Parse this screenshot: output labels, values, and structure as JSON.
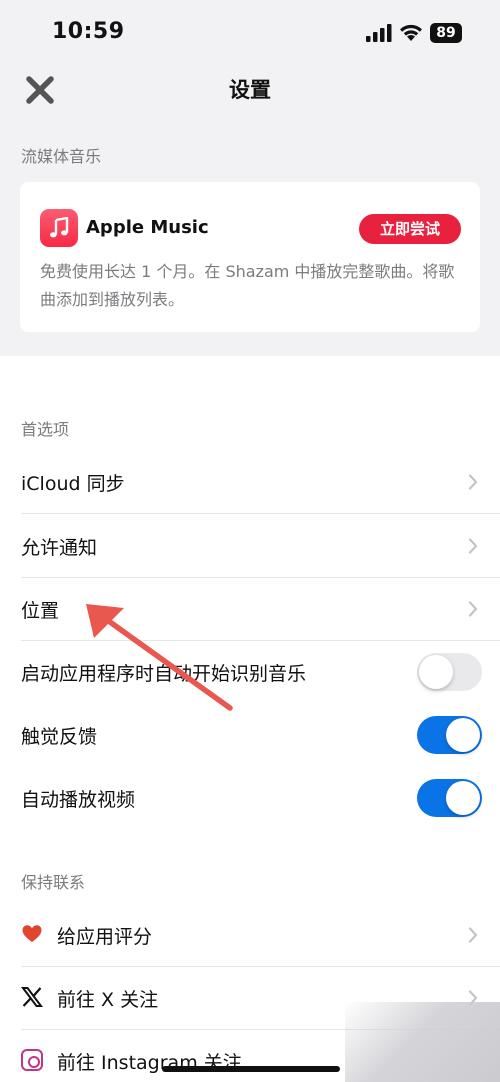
{
  "status_bar": {
    "time": "10:59",
    "battery": "89"
  },
  "nav": {
    "title": "设置"
  },
  "streaming": {
    "section_label": "流媒体音乐",
    "apple_music": {
      "title": "Apple Music",
      "try_button": "立即尝试",
      "description": "免费使用长达 1 个月。在 Shazam 中播放完整歌曲。将歌曲添加到播放列表。"
    }
  },
  "preferences": {
    "section_label": "首选项",
    "items": [
      {
        "label": "iCloud 同步",
        "type": "link"
      },
      {
        "label": "允许通知",
        "type": "link"
      },
      {
        "label": "位置",
        "type": "link"
      },
      {
        "label": "启动应用程序时自动开始识别音乐",
        "type": "toggle",
        "on": false
      },
      {
        "label": "触觉反馈",
        "type": "toggle",
        "on": true
      },
      {
        "label": "自动播放视频",
        "type": "toggle",
        "on": true
      }
    ]
  },
  "contact": {
    "section_label": "保持联系",
    "items": [
      {
        "label": "给应用评分",
        "icon": "heart-icon"
      },
      {
        "label": "前往 X 关注",
        "icon": "x-logo-icon"
      },
      {
        "label": "前往 Instagram 关注",
        "icon": "instagram-icon"
      }
    ]
  },
  "colors": {
    "accent_blue": "#0a74e6",
    "apple_music_red": "#e8213e",
    "annotation_arrow": "#e8584f"
  }
}
